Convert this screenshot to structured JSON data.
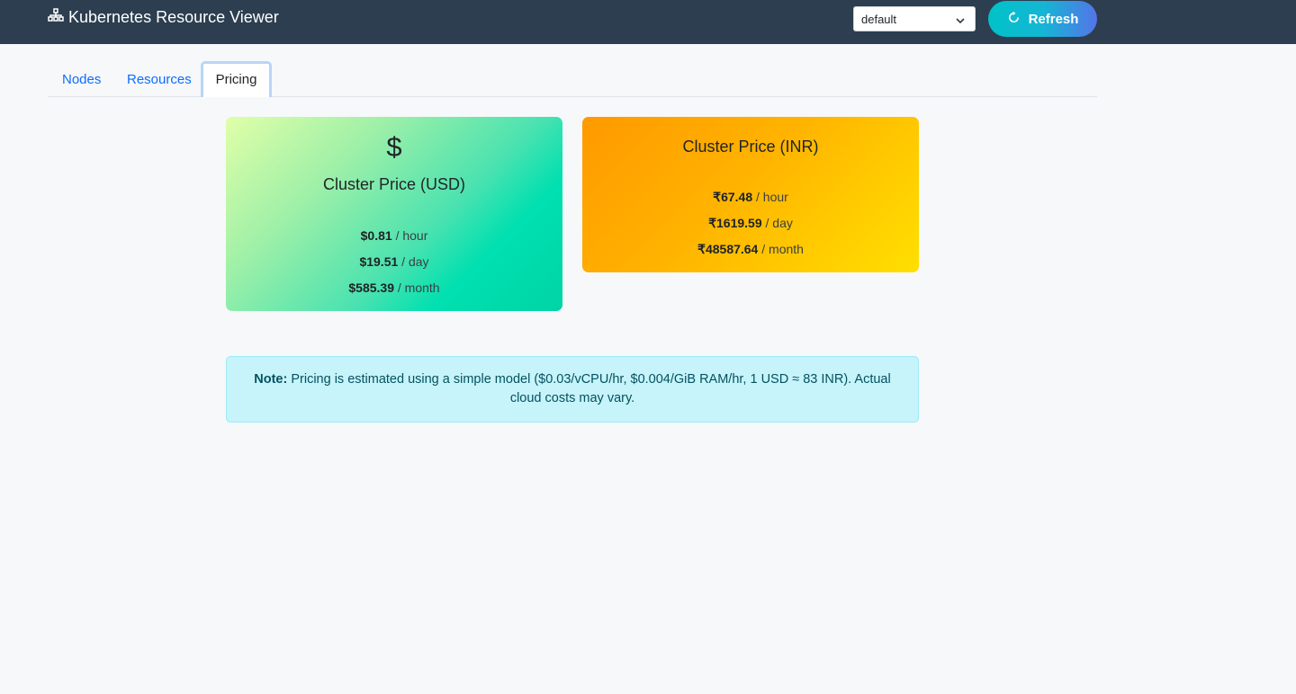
{
  "app": {
    "title": "Kubernetes Resource Viewer",
    "logo_icon": "sitemap-icon"
  },
  "namespace": {
    "selected": "default"
  },
  "refresh": {
    "label": "Refresh",
    "icon": "refresh-icon"
  },
  "tabs": [
    {
      "label": "Nodes",
      "active": false
    },
    {
      "label": "Resources",
      "active": false
    },
    {
      "label": "Pricing",
      "active": true
    }
  ],
  "pricing": {
    "usd": {
      "icon_symbol": "$",
      "title": "Cluster Price (USD)",
      "hour": {
        "value": "$0.81",
        "unit": "/ hour"
      },
      "day": {
        "value": "$19.51",
        "unit": "/ day"
      },
      "month": {
        "value": "$585.39",
        "unit": "/ month"
      }
    },
    "inr": {
      "title": "Cluster Price (INR)",
      "hour": {
        "value": "₹67.48",
        "unit": "/ hour"
      },
      "day": {
        "value": "₹1619.59",
        "unit": "/ day"
      },
      "month": {
        "value": "₹48587.64",
        "unit": "/ month"
      }
    }
  },
  "note": {
    "label": "Note:",
    "text": "Pricing is estimated using a simple model ($0.03/vCPU/hr, $0.004/GiB RAM/hr, 1 USD ≈ 83 INR). Actual cloud costs may vary."
  },
  "colors": {
    "navbar": "#2c3e50",
    "tab_link": "#0d6efd",
    "note_bg": "#c6f4fa"
  }
}
